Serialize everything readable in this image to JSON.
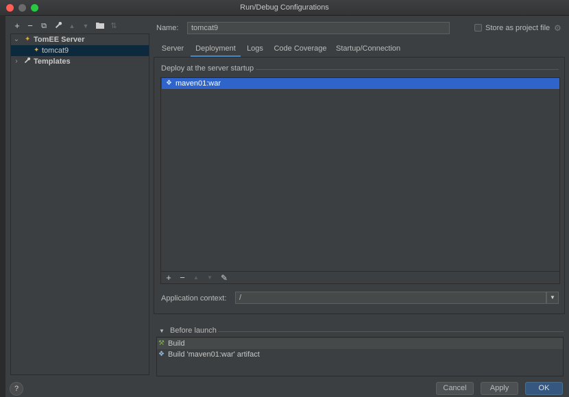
{
  "window": {
    "title": "Run/Debug Configurations",
    "traffic_lights": {
      "close": "#ff5f57",
      "minimize": "#6b6b6b",
      "zoom": "#28c840"
    }
  },
  "toolbar": {
    "icons": [
      {
        "name": "add-icon",
        "glyph": "+",
        "enabled": true
      },
      {
        "name": "remove-icon",
        "glyph": "−",
        "enabled": true
      },
      {
        "name": "copy-icon",
        "glyph": "⧉",
        "enabled": true
      },
      {
        "name": "wrench-icon",
        "glyph": "🔧",
        "enabled": true
      },
      {
        "name": "move-up-icon",
        "glyph": "▲",
        "enabled": false
      },
      {
        "name": "move-down-icon",
        "glyph": "▼",
        "enabled": false
      },
      {
        "name": "folder-icon",
        "glyph": "📁",
        "enabled": true
      },
      {
        "name": "sort-icon",
        "glyph": "⇅",
        "enabled": false
      }
    ]
  },
  "tree": {
    "items": [
      {
        "label": "TomEE Server",
        "expanded": true,
        "bold": true
      },
      {
        "label": "tomcat9",
        "selected": true
      },
      {
        "label": "Templates",
        "expanded": false,
        "bold": true
      }
    ]
  },
  "name_field": {
    "label": "Name:",
    "value": "tomcat9"
  },
  "store_project": {
    "label": "Store as project file",
    "checked": false
  },
  "tabs": [
    {
      "label": "Server",
      "selected": false
    },
    {
      "label": "Deployment",
      "selected": true
    },
    {
      "label": "Logs",
      "selected": false
    },
    {
      "label": "Code Coverage",
      "selected": false
    },
    {
      "label": "Startup/Connection",
      "selected": false
    }
  ],
  "deployment": {
    "section_title": "Deploy at the server startup",
    "items": [
      {
        "label": "maven01:war",
        "selected": true
      }
    ],
    "toolbar": [
      {
        "name": "add-icon",
        "glyph": "+",
        "enabled": true
      },
      {
        "name": "remove-icon",
        "glyph": "−",
        "enabled": true
      },
      {
        "name": "move-up-icon",
        "glyph": "▲",
        "enabled": false
      },
      {
        "name": "move-down-icon",
        "glyph": "▼",
        "enabled": false
      },
      {
        "name": "edit-icon",
        "glyph": "✎",
        "enabled": true
      }
    ]
  },
  "app_context": {
    "label": "Application context:",
    "value": "/"
  },
  "before_launch": {
    "title": "Before launch",
    "items": [
      {
        "label": "Build",
        "icon": "hammer-icon"
      },
      {
        "label": "Build 'maven01:war' artifact",
        "icon": "artifact-icon"
      }
    ]
  },
  "buttons": {
    "help": "?",
    "cancel": "Cancel",
    "apply": "Apply",
    "ok": "OK"
  },
  "colors": {
    "accent": "#4a88c7",
    "selection": "#2f65ca",
    "background": "#3c3f41"
  }
}
